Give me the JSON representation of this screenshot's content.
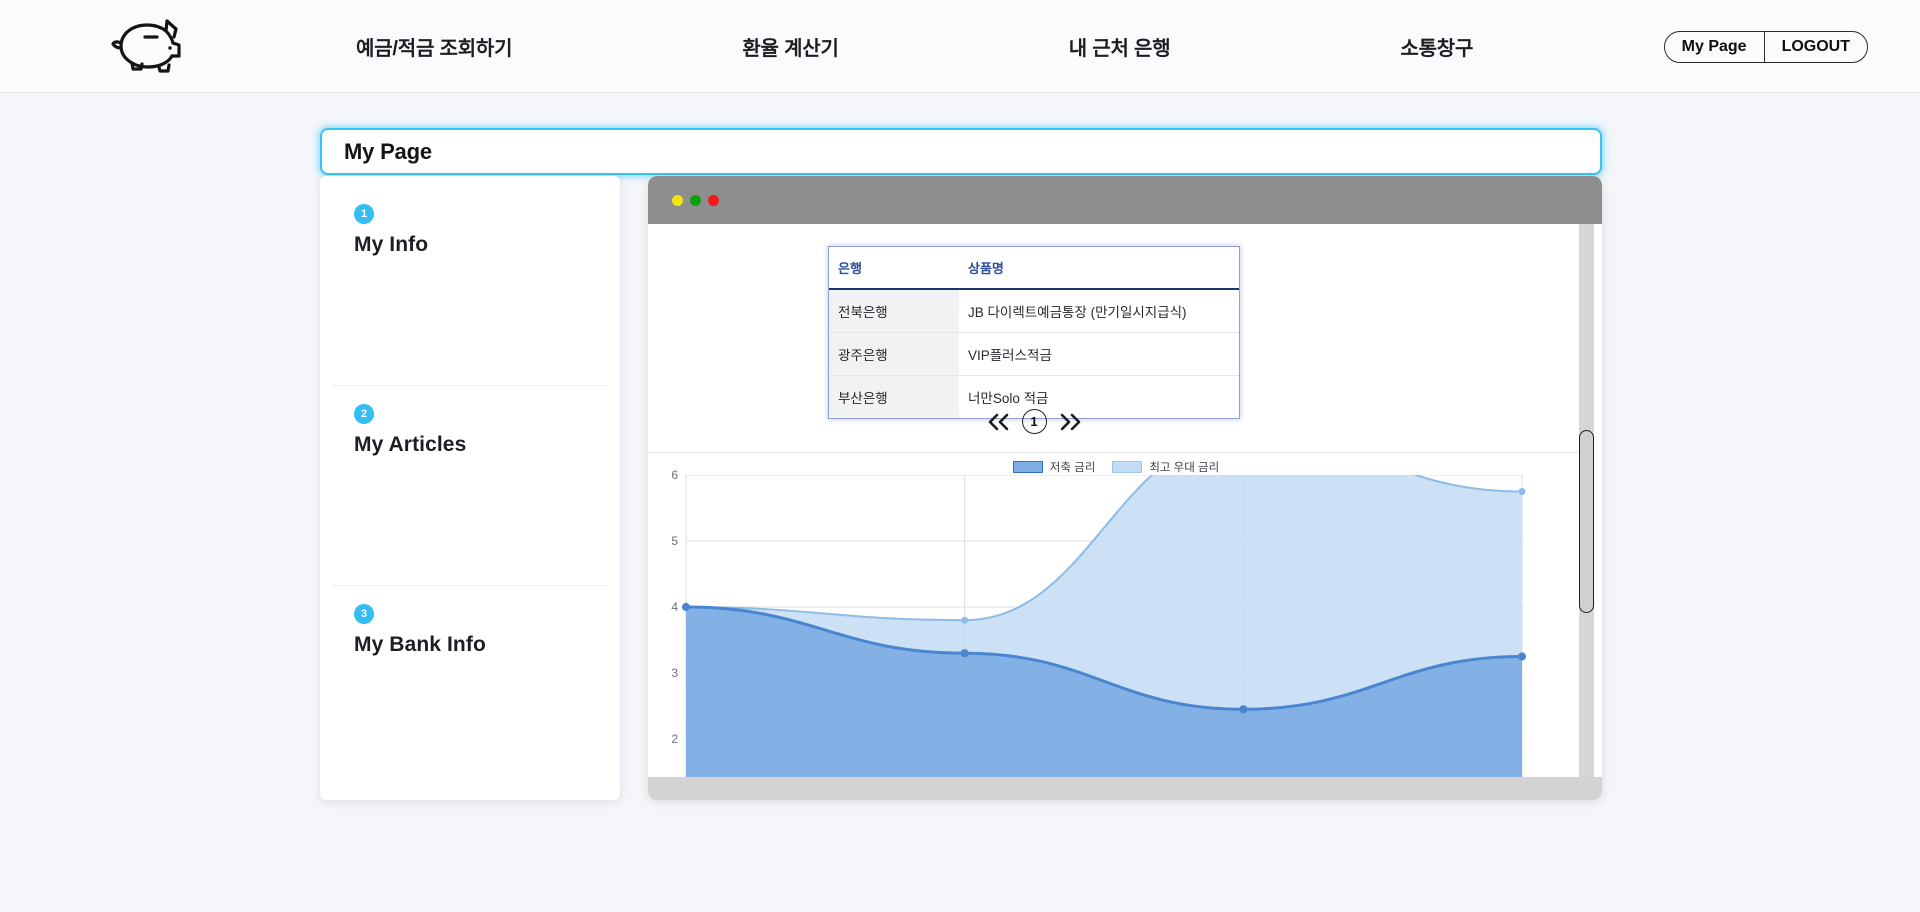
{
  "nav": {
    "logo_icon": "piggy-bank-icon",
    "links": [
      {
        "label": "예금/적금 조회하기"
      },
      {
        "label": "환율 계산기"
      },
      {
        "label": "내 근처 은행"
      },
      {
        "label": "소통창구"
      }
    ],
    "my_page_label": "My Page",
    "logout_label": "LOGOUT"
  },
  "page": {
    "title": "My Page"
  },
  "sidebar": {
    "items": [
      {
        "number": "1",
        "label": "My Info"
      },
      {
        "number": "2",
        "label": "My Articles"
      },
      {
        "number": "3",
        "label": "My Bank Info"
      }
    ]
  },
  "panel": {
    "window_dots": [
      "yellow",
      "green",
      "red"
    ],
    "table": {
      "headers": [
        "은행",
        "상품명"
      ],
      "rows": [
        {
          "bank": "전북은행",
          "product": "JB 다이렉트예금통장 (만기일시지급식)"
        },
        {
          "bank": "광주은행",
          "product": "VIP플러스적금"
        },
        {
          "bank": "부산은행",
          "product": "너만Solo 적금"
        }
      ]
    },
    "pagination": {
      "prev_icon": "double-chevron-left-icon",
      "next_icon": "double-chevron-right-icon",
      "current_page": "1"
    }
  },
  "colors": {
    "accent_cyan": "#35c4f6",
    "badge_blue": "#33bdf2",
    "series_savings": "#7faee4",
    "series_savings_line": "#4a86cf",
    "series_premium": "#c3dbf5",
    "series_premium_line": "#8ebbe8",
    "table_header_text": "#2e4d9b",
    "chrome_gray": "#8e8e8e"
  },
  "chart_data": {
    "type": "area",
    "title": "",
    "xlabel": "",
    "ylabel": "",
    "ylim": [
      2,
      6
    ],
    "yticks": [
      6,
      5,
      4,
      3,
      2
    ],
    "grid": true,
    "legend_position": "top-center",
    "x": [
      0,
      1,
      2,
      3
    ],
    "series": [
      {
        "name": "저축 금리",
        "values": [
          4.0,
          3.3,
          2.45,
          3.25
        ]
      },
      {
        "name": "최고 우대 금리",
        "values": [
          4.0,
          3.8,
          6.6,
          5.75
        ]
      }
    ]
  }
}
